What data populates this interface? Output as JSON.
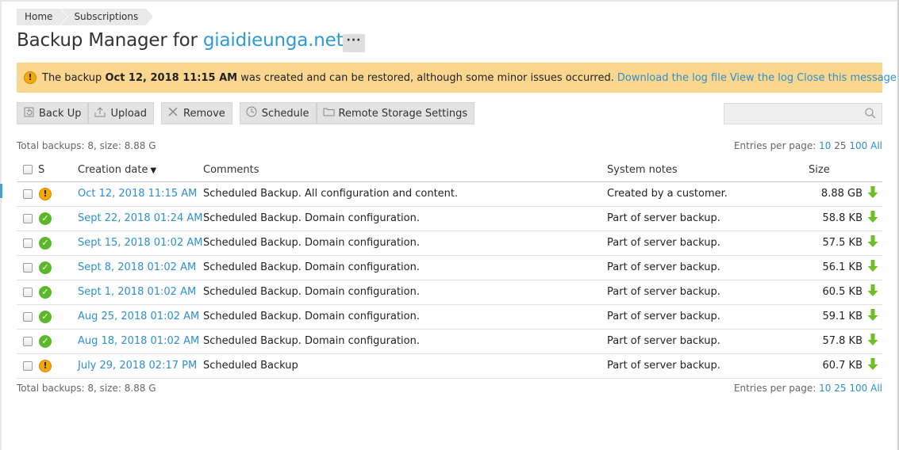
{
  "breadcrumb": {
    "home": "Home",
    "subscriptions": "Subscriptions"
  },
  "page": {
    "title_prefix": "Backup Manager for ",
    "domain": "giaidieunga.net",
    "more_label": "···"
  },
  "alert": {
    "icon": "warning-icon",
    "text_before": "The backup ",
    "date": "Oct 12, 2018 11:15 AM",
    "text_after": " was created and can be restored, although some minor issues occurred.",
    "link_download": "Download the log file",
    "link_view": "View the log",
    "link_close": "Close this message",
    "color": "#fbd68f"
  },
  "toolbar": {
    "backup": "Back Up",
    "upload": "Upload",
    "remove": "Remove",
    "schedule": "Schedule",
    "remote": "Remote Storage Settings"
  },
  "search": {
    "placeholder": "",
    "value": ""
  },
  "summary": {
    "top": "Total backups: 8, size: 8.88 G",
    "bottom": "Total backups: 8, size: 8.88 G"
  },
  "pagination": {
    "label": "Entries per page:",
    "options": [
      "10",
      "25",
      "100",
      "All"
    ]
  },
  "table": {
    "headers": {
      "status": "S",
      "date": "Creation date",
      "comments": "Comments",
      "notes": "System notes",
      "size": "Size"
    },
    "rows": [
      {
        "status": "warning",
        "date": "Oct 12, 2018 11:15 AM",
        "comment": "Scheduled Backup. All configuration and content.",
        "notes": "Created by a customer.",
        "size": "8.88 GB"
      },
      {
        "status": "ok",
        "date": "Sept 22, 2018 01:24 AM",
        "comment": "Scheduled Backup. Domain configuration.",
        "notes": "Part of server backup.",
        "size": "58.8 KB"
      },
      {
        "status": "ok",
        "date": "Sept 15, 2018 01:02 AM",
        "comment": "Scheduled Backup. Domain configuration.",
        "notes": "Part of server backup.",
        "size": "57.5 KB"
      },
      {
        "status": "ok",
        "date": "Sept 8, 2018 01:02 AM",
        "comment": "Scheduled Backup. Domain configuration.",
        "notes": "Part of server backup.",
        "size": "56.1 KB"
      },
      {
        "status": "ok",
        "date": "Sept 1, 2018 01:02 AM",
        "comment": "Scheduled Backup. Domain configuration.",
        "notes": "Part of server backup.",
        "size": "60.5 KB"
      },
      {
        "status": "ok",
        "date": "Aug 25, 2018 01:02 AM",
        "comment": "Scheduled Backup. Domain configuration.",
        "notes": "Part of server backup.",
        "size": "59.1 KB"
      },
      {
        "status": "ok",
        "date": "Aug 18, 2018 01:02 AM",
        "comment": "Scheduled Backup. Domain configuration.",
        "notes": "Part of server backup.",
        "size": "57.8 KB"
      },
      {
        "status": "warning",
        "date": "July 29, 2018 02:17 PM",
        "comment": "Scheduled Backup",
        "notes": "Part of server backup.",
        "size": "60.7 KB"
      }
    ]
  },
  "colors": {
    "link": "#2d8fd0",
    "ok": "#5cb82a",
    "warning": "#f5a800",
    "download": "#6cc024"
  }
}
